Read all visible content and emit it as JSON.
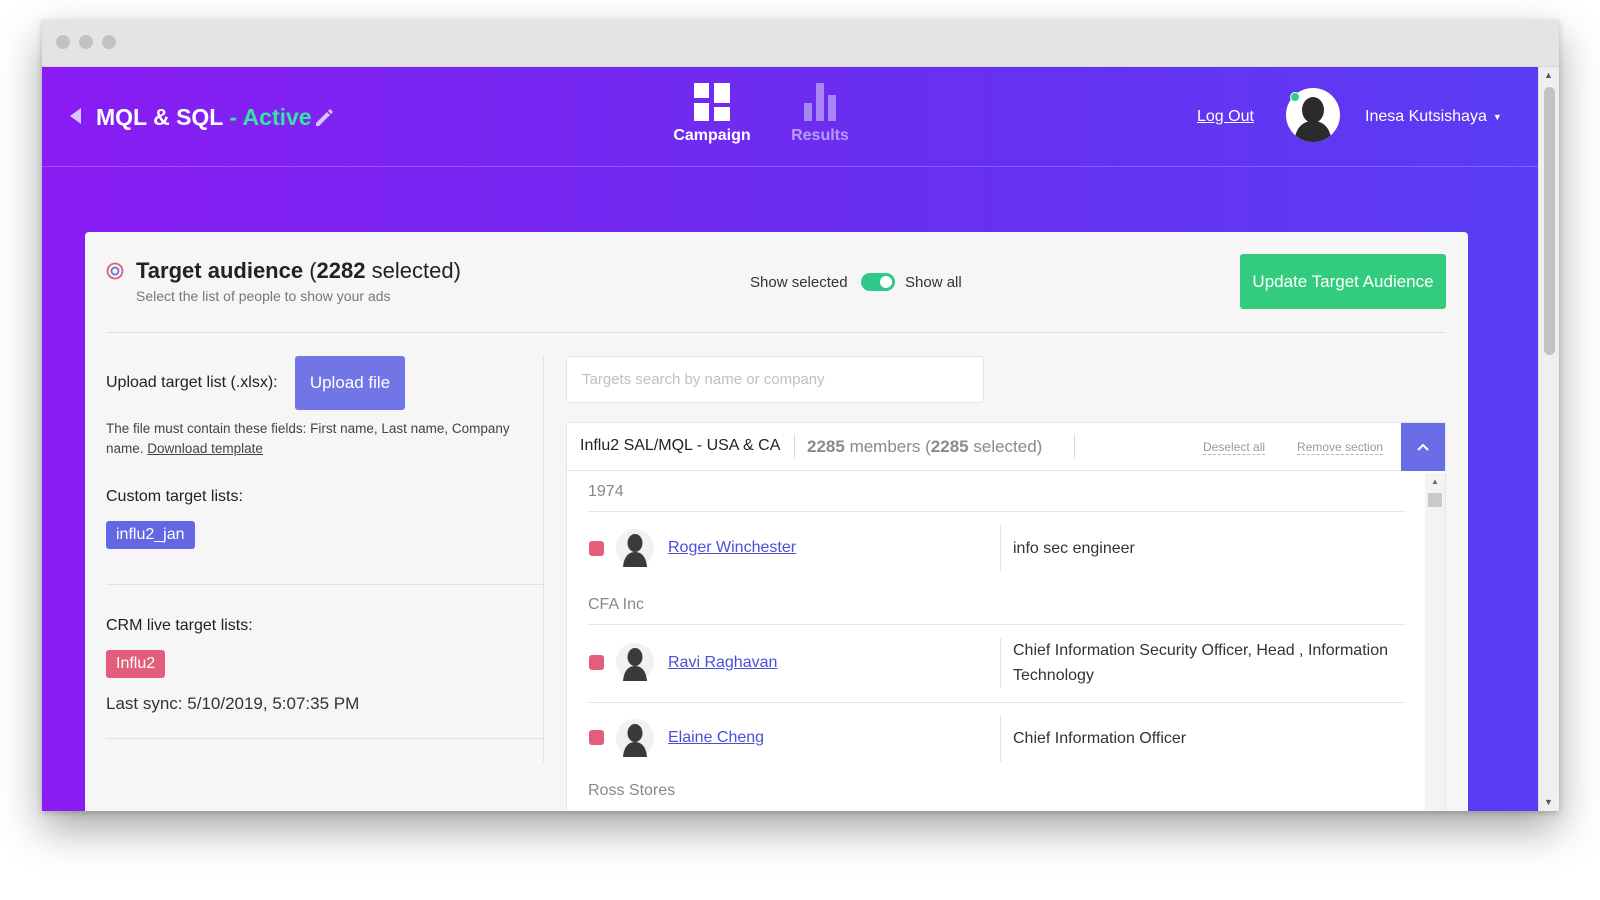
{
  "header": {
    "title_main": "MQL & SQL",
    "title_sep": " - ",
    "title_status": "Active",
    "nav": [
      {
        "label": "Campaign",
        "icon": "dashboard-icon",
        "active": true
      },
      {
        "label": "Results",
        "icon": "bar-chart-icon",
        "active": false
      }
    ],
    "logout": "Log Out",
    "user_name": "Inesa Kutsishaya"
  },
  "target_audience": {
    "title": "Target audience",
    "count": "2282",
    "count_suffix": "selected)",
    "subtitle": "Select the list of people to show your ads",
    "show_selected": "Show selected",
    "show_all": "Show all",
    "update_button": "Update Target Audience"
  },
  "left_panel": {
    "upload_label": "Upload target list (.xlsx):",
    "upload_button": "Upload file",
    "note": "The file must contain these fields: First name, Last name, Company name.",
    "download_link": "Download template",
    "custom_lists_label": "Custom target lists:",
    "custom_lists": [
      "influ2_jan"
    ],
    "crm_lists_label": "CRM live target lists:",
    "crm_lists": [
      "Influ2"
    ],
    "last_sync": "Last sync: 5/10/2019, 5:07:35 PM"
  },
  "targets": {
    "search_placeholder": "Targets search by name or company",
    "segment_name": "Influ2 SAL/MQL - USA & CA",
    "members_total": "2285",
    "members_word": "members (",
    "members_selected": "2285",
    "members_selected_word": "selected)",
    "deselect_all": "Deselect all",
    "remove_section": "Remove section",
    "groups": [
      {
        "company": "1974",
        "people": [
          {
            "name": "Roger Winchester",
            "title": "info sec engineer"
          }
        ]
      },
      {
        "company": "CFA Inc",
        "people": [
          {
            "name": "Ravi Raghavan",
            "title": "Chief Information Security Officer, Head , Information Technology"
          },
          {
            "name": "Elaine Cheng",
            "title": "Chief Information Officer"
          }
        ]
      },
      {
        "company": "Ross Stores",
        "people": []
      }
    ]
  },
  "colors": {
    "accent_green": "#33cc7e",
    "active_green": "#35e4a4",
    "primary_blue": "#6a6ee6",
    "tag_red": "#e25e7a",
    "gradient_start": "#8a1cf3",
    "gradient_end": "#5b3cf5"
  }
}
